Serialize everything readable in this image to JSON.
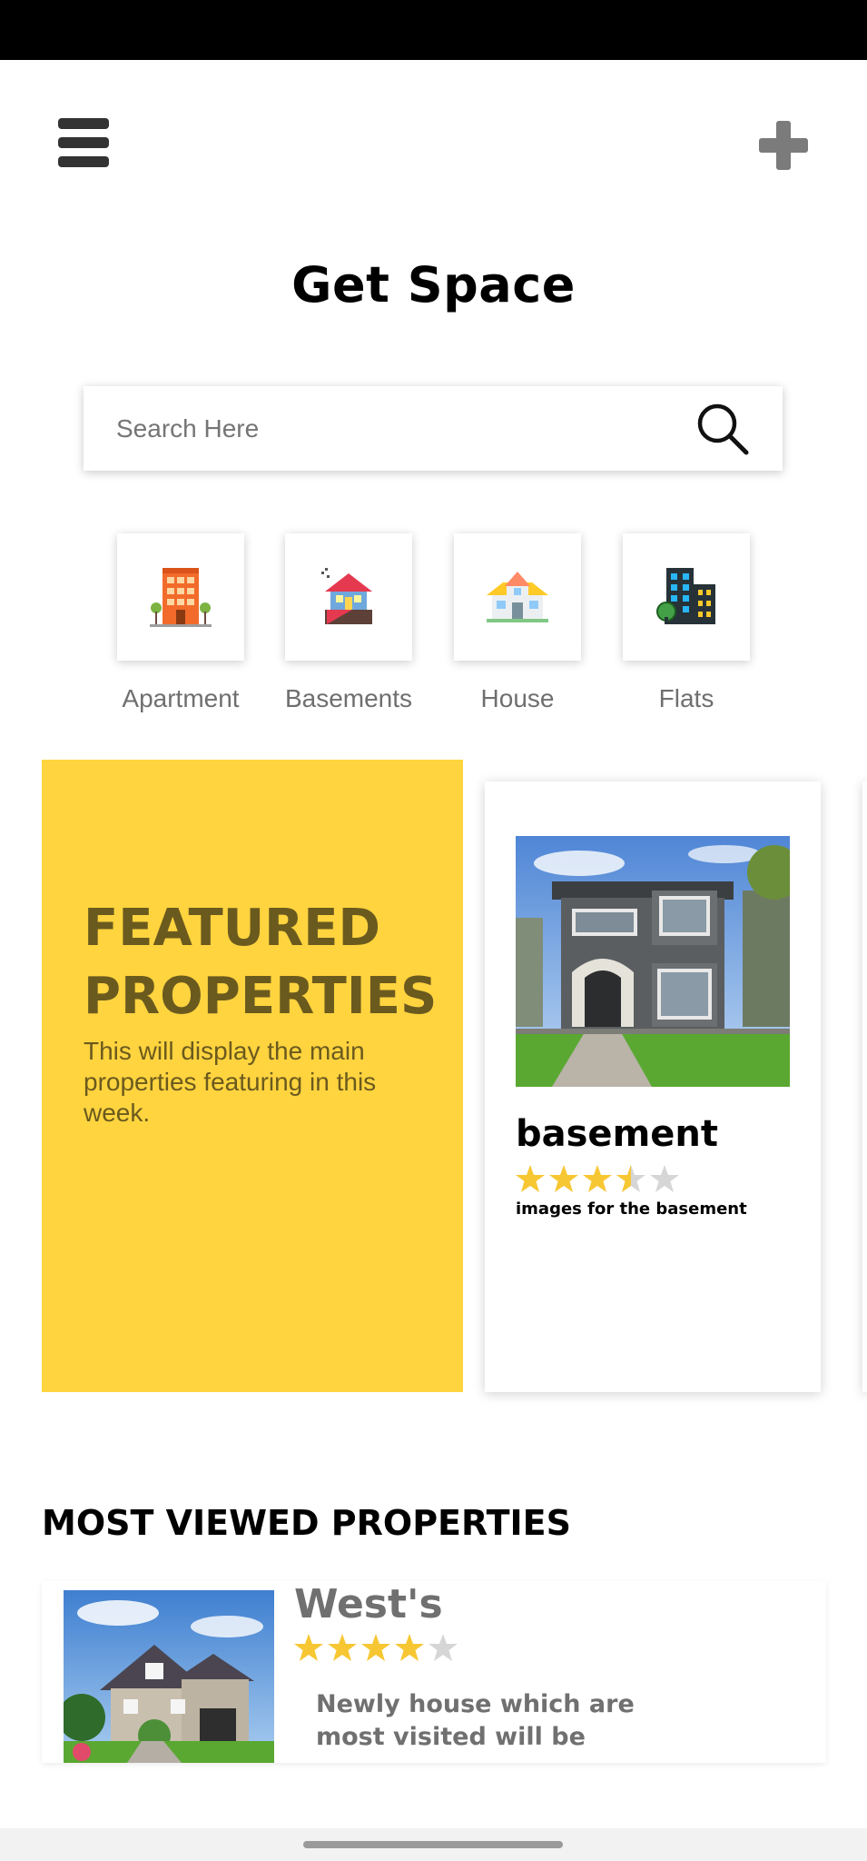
{
  "app": {
    "title": "Get Space"
  },
  "header": {
    "menu_icon": "hamburger-menu-icon",
    "add_icon": "plus-icon"
  },
  "search": {
    "placeholder": "Search Here",
    "value": "",
    "icon": "search-icon"
  },
  "categories": [
    {
      "label": "Apartment",
      "icon": "apartment-building-icon"
    },
    {
      "label": "Basements",
      "icon": "basement-house-icon"
    },
    {
      "label": "House",
      "icon": "house-icon"
    },
    {
      "label": "Flats",
      "icon": "flats-building-icon"
    }
  ],
  "featured": {
    "title": "FEATURED PROPERTIES",
    "description": "This will display the main properties featuring in this week.",
    "banner_color": "#ffd43f",
    "text_color": "#6b5a1e",
    "cards": [
      {
        "name": "basement",
        "rating": 3.5,
        "max_rating": 5,
        "description": "images for the basement"
      }
    ]
  },
  "most_viewed": {
    "title": "MOST VIEWED PROPERTIES",
    "items": [
      {
        "name": "West's",
        "rating": 4,
        "max_rating": 5,
        "description": "Newly house which are most visited will be"
      }
    ]
  },
  "colors": {
    "star_filled": "#f7c733",
    "star_empty": "#d6d6d6"
  }
}
